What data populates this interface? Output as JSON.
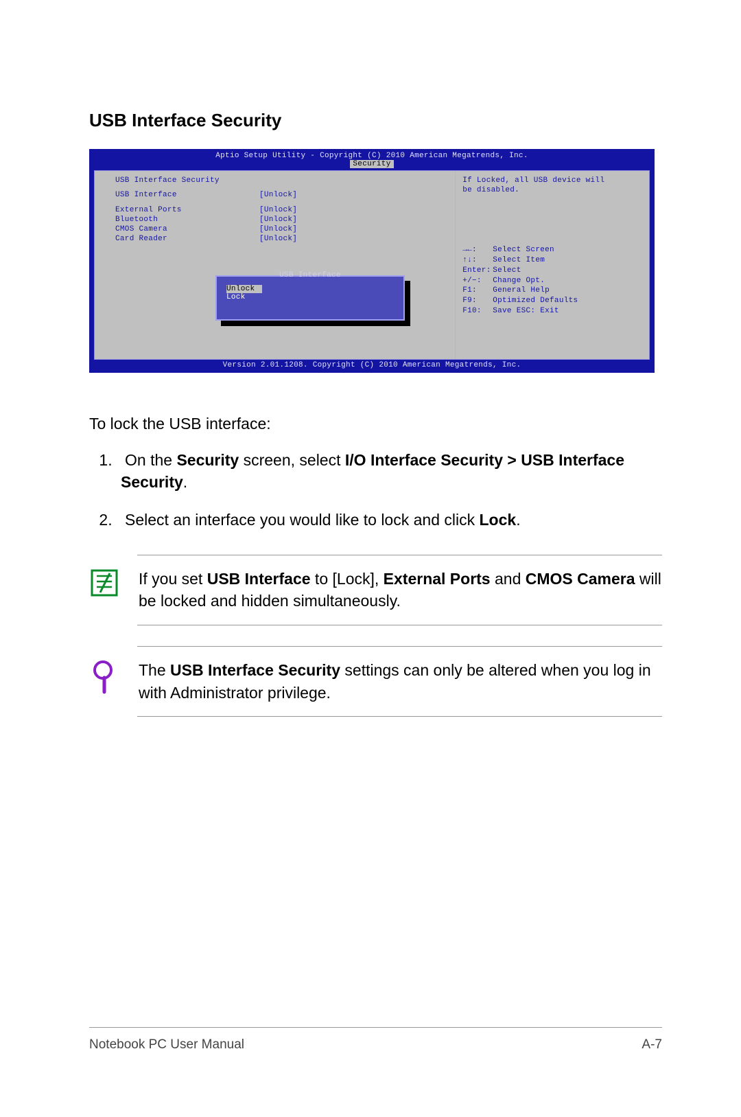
{
  "heading": "USB Interface Security",
  "bios": {
    "title": "Aptio Setup Utility - Copyright (C) 2010 American Megatrends, Inc.",
    "tab": "Security",
    "section_title": "USB Interface Security",
    "rows": [
      {
        "label": "USB Interface",
        "value": "[Unlock]"
      }
    ],
    "group2": [
      {
        "label": "External Ports",
        "value": "[Unlock]"
      },
      {
        "label": "Bluetooth",
        "value": "[Unlock]"
      },
      {
        "label": "CMOS Camera",
        "value": "[Unlock]"
      },
      {
        "label": "Card Reader",
        "value": "[Unlock]"
      }
    ],
    "help_top_line1": "If Locked, all USB device will",
    "help_top_line2": "be disabled.",
    "help_keys": [
      {
        "k": "→←:",
        "d": "Select Screen"
      },
      {
        "k": "↑↓:",
        "d": "Select Item"
      },
      {
        "k": "Enter:",
        "d": "Select",
        "kw": "52"
      },
      {
        "k": "+/−:",
        "d": "Change Opt."
      },
      {
        "k": "F1:",
        "d": "General Help"
      },
      {
        "k": "F9:",
        "d": "Optimized Defaults"
      },
      {
        "k": "F10:",
        "d": "Save   ESC:  Exit"
      }
    ],
    "footer": "Version 2.01.1208. Copyright (C) 2010 American Megatrends, Inc.",
    "popup_title": "USB Interface",
    "popup_items": [
      "Unlock",
      "Lock"
    ]
  },
  "intro": "To lock the USB interface:",
  "step1_a": "On the ",
  "step1_b": "Security",
  "step1_c": " screen, select ",
  "step1_d": "I/O Interface Security > USB Interface Security",
  "step1_e": ".",
  "step2_a": "Select an interface you would like to lock and click ",
  "step2_b": "Lock",
  "step2_c": ".",
  "note1_a": "If you set ",
  "note1_b": "USB Interface",
  "note1_c": " to [Lock], ",
  "note1_d": "External Ports",
  "note1_e": " and ",
  "note1_f": "CMOS Camera",
  "note1_g": " will be locked and hidden simultaneously.",
  "note2_a": "The ",
  "note2_b": "USB Interface Security",
  "note2_c": " settings can only be altered when you log in with Administrator privilege.",
  "footer_left": "Notebook PC User Manual",
  "footer_right": "A-7"
}
